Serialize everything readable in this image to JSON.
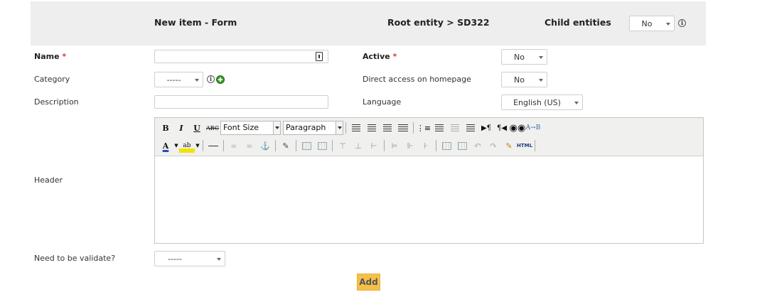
{
  "header": {
    "title": "New item - Form",
    "breadcrumb": "Root entity > SD322",
    "child_entities_label": "Child entities",
    "child_entities_value": "No"
  },
  "form": {
    "name_label": "Name",
    "required_mark": "*",
    "name_value": "",
    "active_label": "Active",
    "active_value": "No",
    "category_label": "Category",
    "category_value": "-----",
    "direct_access_label": "Direct access on homepage",
    "direct_access_value": "No",
    "description_label": "Description",
    "description_value": "",
    "language_label": "Language",
    "language_value": "English (US)",
    "header_label": "Header",
    "validate_label": "Need to be validate?",
    "validate_value": "-----",
    "add_label": "Add"
  },
  "toolbar": {
    "font_size": "Font Size",
    "paragraph": "Paragraph",
    "bold": "B",
    "italic": "I",
    "underline": "U",
    "strike": "ABC",
    "html": "HTML"
  },
  "colors": {
    "header_bg": "#eeeeee",
    "required": "#dd3333",
    "add_button": "#f5c04a"
  }
}
